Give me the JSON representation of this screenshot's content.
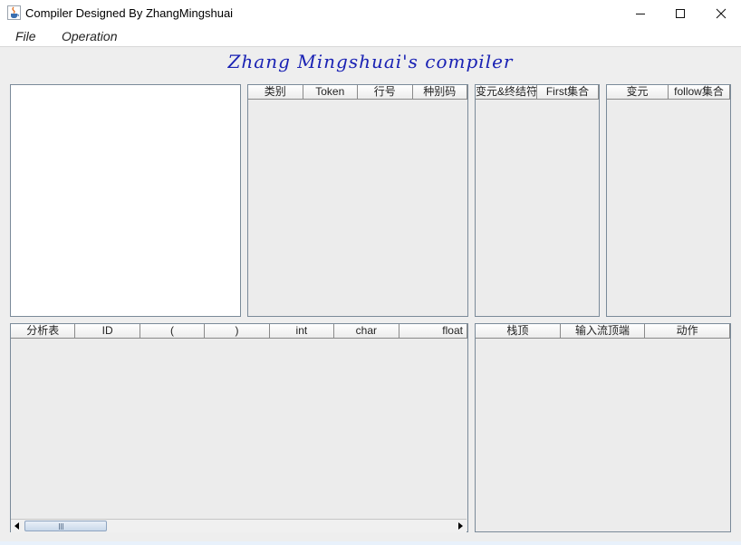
{
  "window": {
    "title": "Compiler Designed By ZhangMingshuai"
  },
  "menu": [
    "File",
    "Operation"
  ],
  "heading": "Zhang Mingshuai's compiler",
  "token_table": {
    "headers": [
      "类别",
      "Token",
      "行号",
      "种别码"
    ]
  },
  "first_table": {
    "headers": [
      "变元&终结符",
      "First集合"
    ]
  },
  "follow_table": {
    "headers": [
      "变元",
      "follow集合"
    ]
  },
  "parse_table": {
    "headers": [
      "分析表",
      "ID",
      "(",
      ")",
      "int",
      "char",
      "float"
    ]
  },
  "stack_table": {
    "headers": [
      "栈顶",
      "输入流顶端",
      "动作"
    ]
  },
  "colors": {
    "heading": "#1a22b4",
    "panel_border": "#7a8a99",
    "background": "#eeeeee"
  },
  "icons": [
    "java-icon",
    "minimize-icon",
    "maximize-icon",
    "close-icon",
    "arrow-left-icon",
    "arrow-right-icon",
    "scroll-thumb-grip-icon"
  ]
}
